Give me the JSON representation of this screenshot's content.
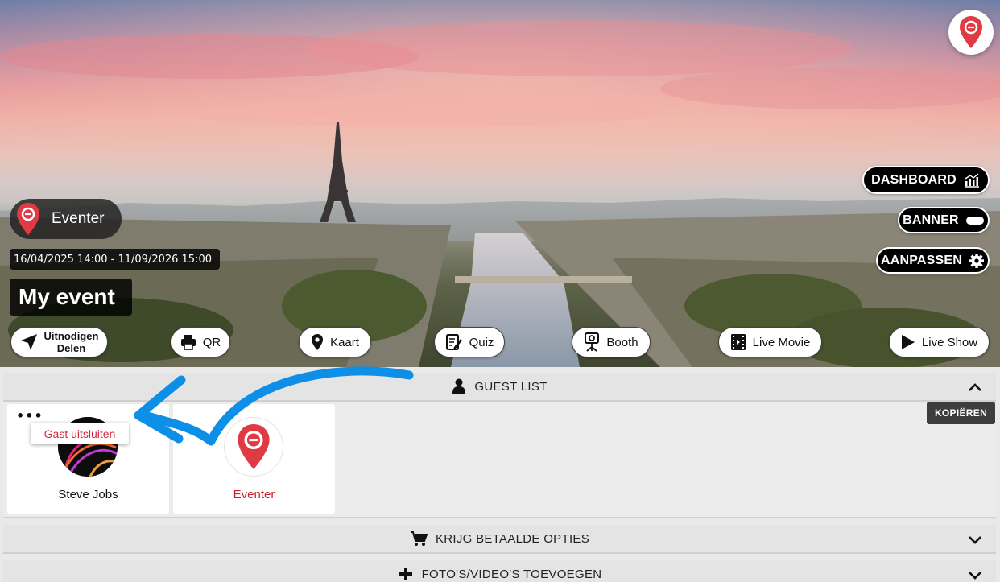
{
  "hero": {
    "organizer_name": "Eventer",
    "date_range": "16/04/2025 14:00 - 11/09/2026 15:00",
    "event_title": "My event"
  },
  "right_buttons": {
    "dashboard": "DASHBOARD",
    "banner": "BANNER",
    "customize": "AANPASSEN"
  },
  "actions": {
    "invite_line1": "Uitnodigen",
    "invite_line2": "Delen",
    "qr": "QR",
    "map": "Kaart",
    "quiz": "Quiz",
    "booth": "Booth",
    "live_movie": "Live Movie",
    "live_show": "Live Show"
  },
  "sections": {
    "guest_list": "GUEST LIST",
    "paid_options": "KRIJG BETAALDE OPTIES",
    "add_media": "FOTO'S/VIDEO'S TOEVOEGEN"
  },
  "guests": [
    {
      "name": "Steve Jobs"
    },
    {
      "name": "Eventer"
    }
  ],
  "guest_menu": {
    "exclude_label": "Gast uitsluiten"
  },
  "copy_label": "KOPIËREN",
  "colors": {
    "brand_red": "#e03a44",
    "guest_name_red": "#c8222f",
    "arrow_blue": "#0d8fe8"
  }
}
